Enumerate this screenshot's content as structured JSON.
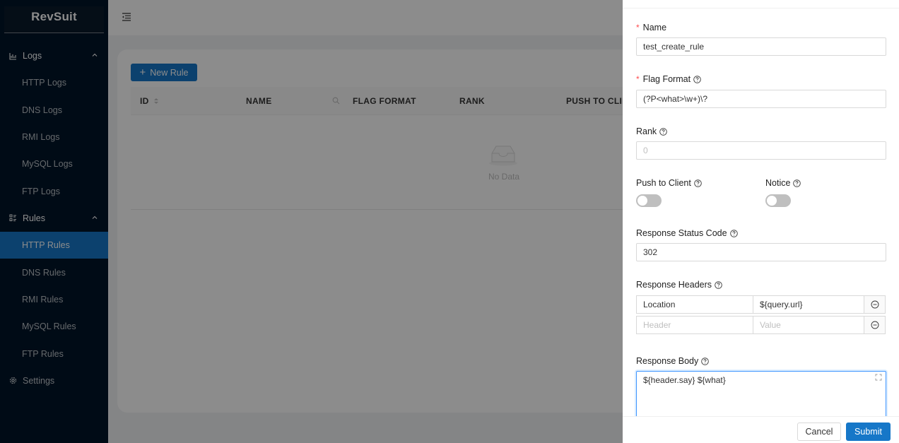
{
  "app": {
    "title": "RevSuit"
  },
  "sidebar": {
    "groups": [
      {
        "label": "Logs",
        "icon": "line-chart-icon",
        "items": [
          "HTTP Logs",
          "DNS Logs",
          "RMI Logs",
          "MySQL Logs",
          "FTP Logs"
        ]
      },
      {
        "label": "Rules",
        "icon": "rules-list-icon",
        "items": [
          "HTTP Rules",
          "DNS Rules",
          "RMI Rules",
          "MySQL Rules",
          "FTP Rules"
        ]
      }
    ],
    "settings": "Settings",
    "active_item": "HTTP Rules",
    "colors": {
      "background": "#001529",
      "active": "#1677c8"
    }
  },
  "toolbar": {
    "new_rule": "New Rule"
  },
  "table": {
    "columns": [
      "ID",
      "NAME",
      "FLAG FORMAT",
      "RANK",
      "PUSH TO CLIENT"
    ],
    "empty_text": "No Data"
  },
  "drawer": {
    "name": {
      "label": "Name",
      "value": "test_create_rule"
    },
    "flag_format": {
      "label": "Flag Format",
      "value": "(?P<what>\\w+)\\?"
    },
    "rank": {
      "label": "Rank",
      "placeholder": "0"
    },
    "push_to_client": {
      "label": "Push to Client",
      "enabled": false
    },
    "notice": {
      "label": "Notice",
      "enabled": false
    },
    "response_status_code": {
      "label": "Response Status Code",
      "value": "302"
    },
    "response_headers": {
      "label": "Response Headers",
      "rows": [
        {
          "key": "Location",
          "value": "${query.url}"
        },
        {
          "key_placeholder": "Header",
          "value_placeholder": "Value"
        }
      ]
    },
    "response_body": {
      "label": "Response Body",
      "value": "${header.say} ${what}"
    },
    "cancel": "Cancel",
    "submit": "Submit",
    "colors": {
      "primary": "#1677c8",
      "required": "#ff4d4f"
    }
  }
}
